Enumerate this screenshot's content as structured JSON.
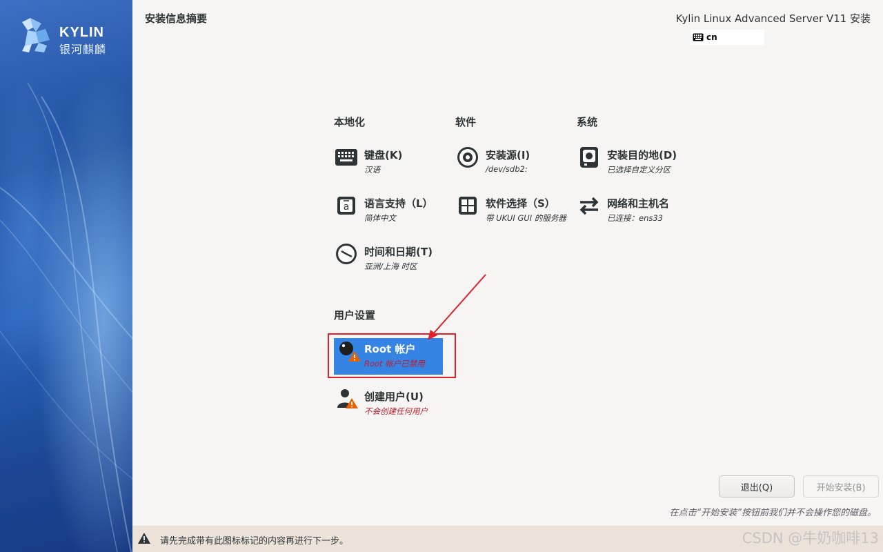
{
  "sidebar": {
    "logo_text": "KYLIN",
    "logo_cn": "银河麒麟"
  },
  "header": {
    "title": "安装信息摘要",
    "product": "Kylin Linux Advanced Server V11 安装",
    "keyboard_layout": "cn"
  },
  "sections": {
    "localization": "本地化",
    "software": "软件",
    "system": "系统",
    "user_settings": "用户设置"
  },
  "spokes": {
    "keyboard": {
      "title": "键盘(K)",
      "status": "汉语",
      "icon": "keyboard-icon"
    },
    "language": {
      "title": "语言支持（L）",
      "status": "简体中文",
      "icon": "language-icon"
    },
    "time": {
      "title": "时间和日期(T)",
      "status": "亚洲/上海 时区",
      "icon": "clock-icon"
    },
    "source": {
      "title": "安装源(I)",
      "status": "/dev/sdb2:",
      "icon": "disc-icon"
    },
    "software_selection": {
      "title": "软件选择（S）",
      "status": "带 UKUI GUI 的服务器",
      "icon": "package-icon"
    },
    "destination": {
      "title": "安装目的地(D)",
      "status": "已选择自定义分区",
      "icon": "harddisk-icon"
    },
    "network": {
      "title": "网络和主机名",
      "status": "已连接：ens33",
      "icon": "network-arrows-icon"
    },
    "root": {
      "title": "Root 帐户",
      "status": "Root 帐户已禁用",
      "icon": "root-user-warning-icon"
    },
    "user": {
      "title": "创建用户(U)",
      "status": "不会创建任何用户",
      "icon": "user-warning-icon"
    }
  },
  "buttons": {
    "quit": "退出(Q)",
    "begin": "开始安装(B)"
  },
  "hint": "在点击“开始安装”按钮前我们并不会操作您的磁盘。",
  "warning_bar": "请先完成带有此图标标记的内容再进行下一步。",
  "watermark": "CSDN @牛奶咖啡13",
  "colors": {
    "accent": "#3584e4",
    "warning": "#c01c28",
    "annotation": "#e0202a"
  }
}
